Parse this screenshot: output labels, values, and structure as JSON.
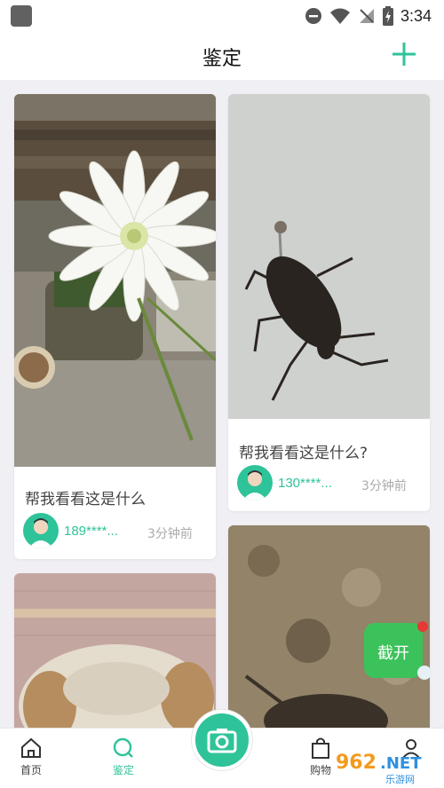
{
  "status_bar": {
    "time": "3:34"
  },
  "header": {
    "title": "鉴定"
  },
  "cards": [
    {
      "text": "帮我看看这是什么",
      "user": "189****...",
      "time": "3分钟前"
    },
    {
      "text": "帮我看看这是什么?",
      "user": "130****...",
      "time": "3分钟前"
    }
  ],
  "float_badge": {
    "label": "截开"
  },
  "nav": {
    "home": "首页",
    "identify": "鉴定",
    "shop": "购物",
    "me": ""
  },
  "watermark": {
    "text": "962.NET",
    "sub": "乐游网"
  },
  "colors": {
    "accent": "#2fc39a",
    "text": "#444444",
    "muted": "#aaaaaa"
  }
}
